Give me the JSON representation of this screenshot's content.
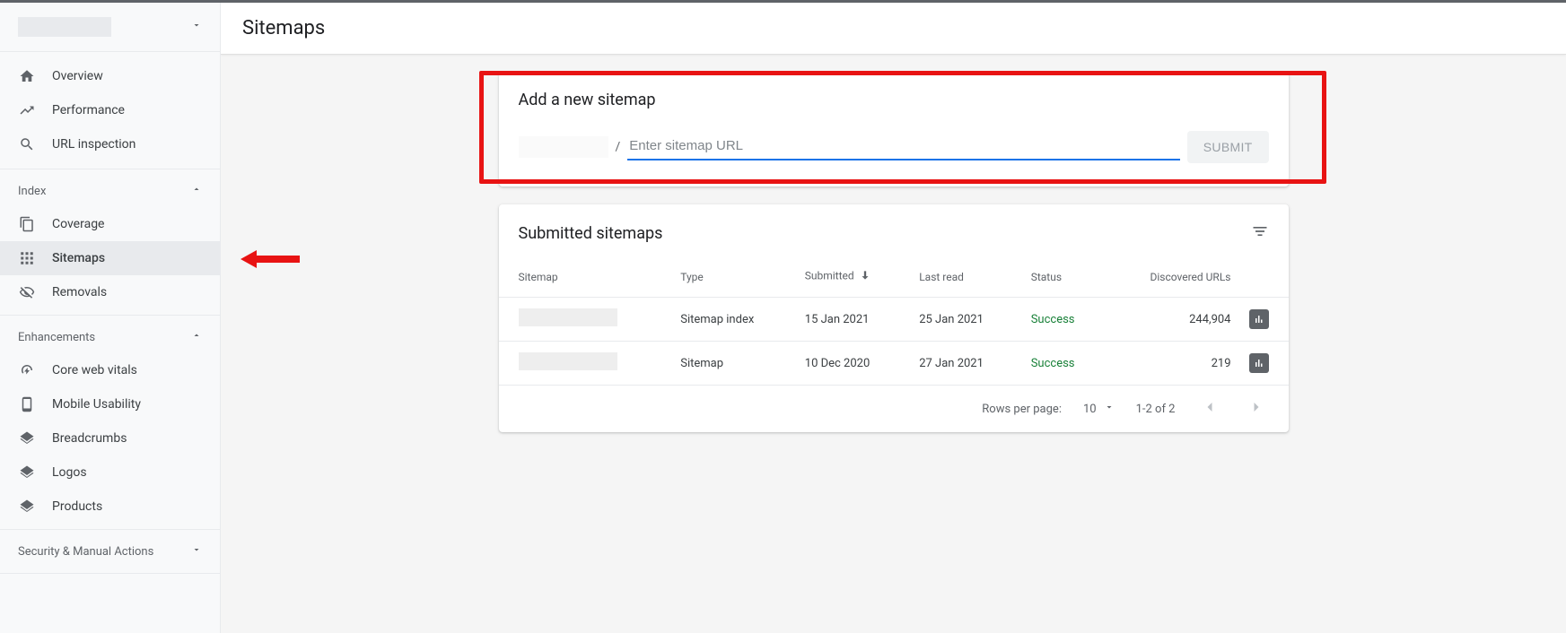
{
  "header": {
    "title": "Sitemaps"
  },
  "sidebar": {
    "top": [
      {
        "label": "Overview"
      },
      {
        "label": "Performance"
      },
      {
        "label": "URL inspection"
      }
    ],
    "sections": [
      {
        "title": "Index",
        "items": [
          {
            "label": "Coverage"
          },
          {
            "label": "Sitemaps",
            "selected": true
          },
          {
            "label": "Removals"
          }
        ]
      },
      {
        "title": "Enhancements",
        "items": [
          {
            "label": "Core web vitals"
          },
          {
            "label": "Mobile Usability"
          },
          {
            "label": "Breadcrumbs"
          },
          {
            "label": "Logos"
          },
          {
            "label": "Products"
          }
        ]
      },
      {
        "title": "Security & Manual Actions",
        "collapsed": true
      }
    ]
  },
  "add_sitemap": {
    "title": "Add a new sitemap",
    "prefix_separator": "/",
    "placeholder": "Enter sitemap URL",
    "submit_label": "SUBMIT"
  },
  "submitted": {
    "title": "Submitted sitemaps",
    "columns": {
      "sitemap": "Sitemap",
      "type": "Type",
      "submitted": "Submitted",
      "last_read": "Last read",
      "status": "Status",
      "discovered": "Discovered URLs"
    },
    "rows": [
      {
        "type": "Sitemap index",
        "submitted": "15 Jan 2021",
        "last_read": "25 Jan 2021",
        "status": "Success",
        "discovered": "244,904"
      },
      {
        "type": "Sitemap",
        "submitted": "10 Dec 2020",
        "last_read": "27 Jan 2021",
        "status": "Success",
        "discovered": "219"
      }
    ],
    "footer": {
      "rows_per_page_label": "Rows per page:",
      "rows_per_page_value": "10",
      "range": "1-2 of 2"
    }
  }
}
